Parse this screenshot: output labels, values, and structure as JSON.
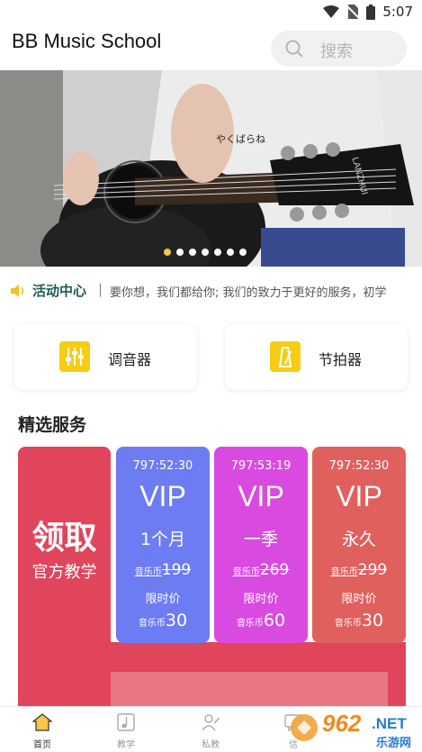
{
  "status_bar": {
    "time": "5:07"
  },
  "header": {
    "title": "BB Music School",
    "search_placeholder": "搜索"
  },
  "banner": {
    "brand_text": "LANZHUI",
    "shirt_text": "やくばらね",
    "slide_count": 7,
    "active_slide": 1
  },
  "notice": {
    "title": "活动中心",
    "separator": "|",
    "text": "要你想，我们都给你; 我们的致力于更好的服务，初学"
  },
  "tools": [
    {
      "label": "调音器",
      "icon": "tuner-icon"
    },
    {
      "label": "节拍器",
      "icon": "metronome-icon"
    }
  ],
  "section_title": "精选服务",
  "claim": {
    "big": "领取",
    "sub": "官方教学"
  },
  "vip_cards": [
    {
      "timer": "797:52:30",
      "title": "VIP",
      "period": "1个月",
      "orig_unit": "音乐币",
      "orig_price": "199",
      "limit_label": "限时价",
      "now_unit": "音乐币",
      "now_price": "30",
      "color": "#6d7cf2"
    },
    {
      "timer": "797:53:19",
      "title": "VIP",
      "period": "一季",
      "orig_unit": "音乐币",
      "orig_price": "269",
      "limit_label": "限时价",
      "now_unit": "音乐币",
      "now_price": "60",
      "color": "#d94be0"
    },
    {
      "timer": "797:52:30",
      "title": "VIP",
      "period": "永久",
      "orig_unit": "音乐币",
      "orig_price": "299",
      "limit_label": "限时价",
      "now_unit": "音乐币",
      "now_price": "30",
      "color": "#e0605e"
    }
  ],
  "bottom_nav": [
    {
      "label": "首页",
      "icon": "home-icon",
      "active": true
    },
    {
      "label": "教学",
      "icon": "music-note-icon",
      "active": false
    },
    {
      "label": "私教",
      "icon": "teacher-icon",
      "active": false
    },
    {
      "label": "信",
      "icon": "message-icon",
      "active": false
    }
  ],
  "watermark": {
    "text": "962",
    "sub": "乐游网",
    "net": ".NET"
  },
  "colors": {
    "accent_yellow": "#f6c644",
    "claim_red": "#e0455c",
    "notice_title": "#1f5a53"
  }
}
